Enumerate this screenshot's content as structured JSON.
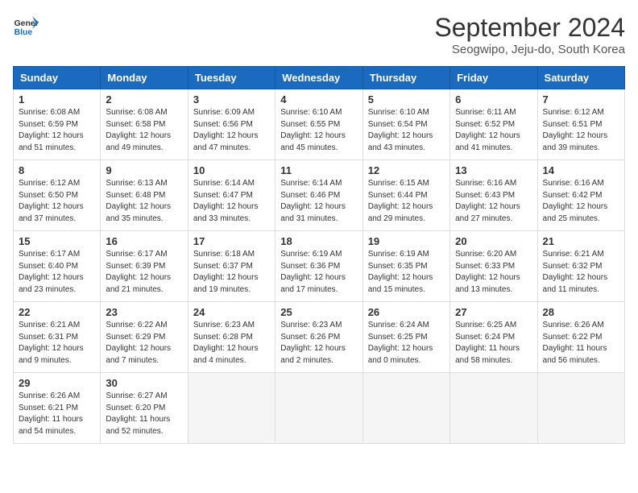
{
  "header": {
    "logo_line1": "General",
    "logo_line2": "Blue",
    "month_title": "September 2024",
    "location": "Seogwipo, Jeju-do, South Korea"
  },
  "days_of_week": [
    "Sunday",
    "Monday",
    "Tuesday",
    "Wednesday",
    "Thursday",
    "Friday",
    "Saturday"
  ],
  "weeks": [
    [
      {
        "day": "1",
        "rise": "6:08 AM",
        "set": "6:59 PM",
        "hours": "12 hours",
        "mins": "51 minutes"
      },
      {
        "day": "2",
        "rise": "6:08 AM",
        "set": "6:58 PM",
        "hours": "12 hours",
        "mins": "49 minutes"
      },
      {
        "day": "3",
        "rise": "6:09 AM",
        "set": "6:56 PM",
        "hours": "12 hours",
        "mins": "47 minutes"
      },
      {
        "day": "4",
        "rise": "6:10 AM",
        "set": "6:55 PM",
        "hours": "12 hours",
        "mins": "45 minutes"
      },
      {
        "day": "5",
        "rise": "6:10 AM",
        "set": "6:54 PM",
        "hours": "12 hours",
        "mins": "43 minutes"
      },
      {
        "day": "6",
        "rise": "6:11 AM",
        "set": "6:52 PM",
        "hours": "12 hours",
        "mins": "41 minutes"
      },
      {
        "day": "7",
        "rise": "6:12 AM",
        "set": "6:51 PM",
        "hours": "12 hours",
        "mins": "39 minutes"
      }
    ],
    [
      {
        "day": "8",
        "rise": "6:12 AM",
        "set": "6:50 PM",
        "hours": "12 hours",
        "mins": "37 minutes"
      },
      {
        "day": "9",
        "rise": "6:13 AM",
        "set": "6:48 PM",
        "hours": "12 hours",
        "mins": "35 minutes"
      },
      {
        "day": "10",
        "rise": "6:14 AM",
        "set": "6:47 PM",
        "hours": "12 hours",
        "mins": "33 minutes"
      },
      {
        "day": "11",
        "rise": "6:14 AM",
        "set": "6:46 PM",
        "hours": "12 hours",
        "mins": "31 minutes"
      },
      {
        "day": "12",
        "rise": "6:15 AM",
        "set": "6:44 PM",
        "hours": "12 hours",
        "mins": "29 minutes"
      },
      {
        "day": "13",
        "rise": "6:16 AM",
        "set": "6:43 PM",
        "hours": "12 hours",
        "mins": "27 minutes"
      },
      {
        "day": "14",
        "rise": "6:16 AM",
        "set": "6:42 PM",
        "hours": "12 hours",
        "mins": "25 minutes"
      }
    ],
    [
      {
        "day": "15",
        "rise": "6:17 AM",
        "set": "6:40 PM",
        "hours": "12 hours",
        "mins": "23 minutes"
      },
      {
        "day": "16",
        "rise": "6:17 AM",
        "set": "6:39 PM",
        "hours": "12 hours",
        "mins": "21 minutes"
      },
      {
        "day": "17",
        "rise": "6:18 AM",
        "set": "6:37 PM",
        "hours": "12 hours",
        "mins": "19 minutes"
      },
      {
        "day": "18",
        "rise": "6:19 AM",
        "set": "6:36 PM",
        "hours": "12 hours",
        "mins": "17 minutes"
      },
      {
        "day": "19",
        "rise": "6:19 AM",
        "set": "6:35 PM",
        "hours": "12 hours",
        "mins": "15 minutes"
      },
      {
        "day": "20",
        "rise": "6:20 AM",
        "set": "6:33 PM",
        "hours": "12 hours",
        "mins": "13 minutes"
      },
      {
        "day": "21",
        "rise": "6:21 AM",
        "set": "6:32 PM",
        "hours": "12 hours",
        "mins": "11 minutes"
      }
    ],
    [
      {
        "day": "22",
        "rise": "6:21 AM",
        "set": "6:31 PM",
        "hours": "12 hours",
        "mins": "9 minutes"
      },
      {
        "day": "23",
        "rise": "6:22 AM",
        "set": "6:29 PM",
        "hours": "12 hours",
        "mins": "7 minutes"
      },
      {
        "day": "24",
        "rise": "6:23 AM",
        "set": "6:28 PM",
        "hours": "12 hours",
        "mins": "4 minutes"
      },
      {
        "day": "25",
        "rise": "6:23 AM",
        "set": "6:26 PM",
        "hours": "12 hours",
        "mins": "2 minutes"
      },
      {
        "day": "26",
        "rise": "6:24 AM",
        "set": "6:25 PM",
        "hours": "12 hours",
        "mins": "0 minutes"
      },
      {
        "day": "27",
        "rise": "6:25 AM",
        "set": "6:24 PM",
        "hours": "11 hours",
        "mins": "58 minutes"
      },
      {
        "day": "28",
        "rise": "6:26 AM",
        "set": "6:22 PM",
        "hours": "11 hours",
        "mins": "56 minutes"
      }
    ],
    [
      {
        "day": "29",
        "rise": "6:26 AM",
        "set": "6:21 PM",
        "hours": "11 hours",
        "mins": "54 minutes"
      },
      {
        "day": "30",
        "rise": "6:27 AM",
        "set": "6:20 PM",
        "hours": "11 hours",
        "mins": "52 minutes"
      },
      null,
      null,
      null,
      null,
      null
    ]
  ]
}
